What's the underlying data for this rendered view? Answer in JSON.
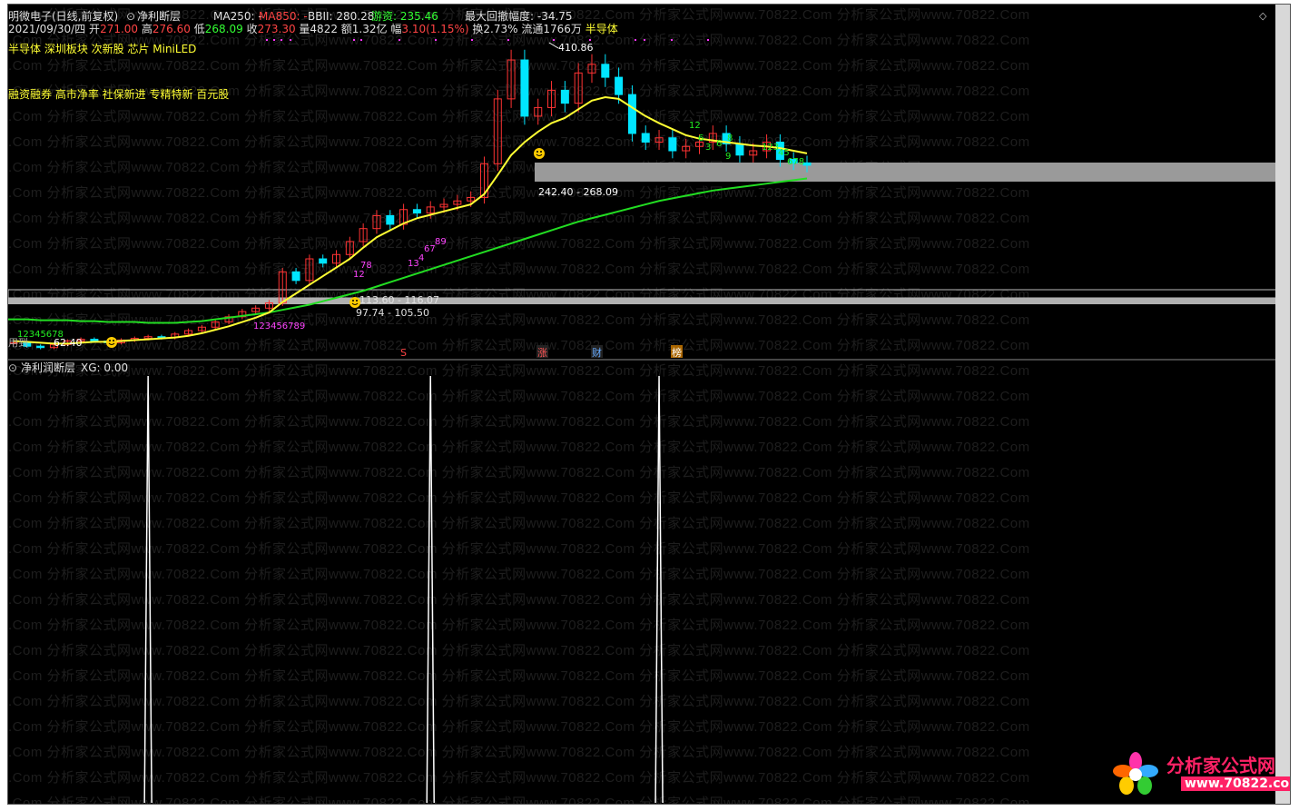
{
  "header": {
    "stock_name": "明微电子(日线,前复权)",
    "indicator_toggle": "⊙",
    "indicator_name": "净利断层",
    "ma250": "MA250: -",
    "ma850": "MA850: -",
    "bbi": "BBII: 280.28",
    "youzi": "游资: 235.46",
    "max_drawdown": "最大回撤幅度: -34.75"
  },
  "quote": {
    "date": "2021/09/30/四",
    "open_label": "开",
    "open": "271.00",
    "high_label": "高",
    "high": "276.60",
    "low_label": "低",
    "low": "268.09",
    "close_label": "收",
    "close": "273.30",
    "volume": "量4822",
    "amount": "额1.32亿",
    "amp_label": "幅",
    "amp": "3.10(1.15%)",
    "turnover": "换2.73%",
    "float": "流通1766万",
    "sector": "半导体"
  },
  "concepts_1": "半导体 深圳板块 次新股 芯片 MiniLED",
  "concepts_2": "融资融券 高市净率 社保新进 专精特新 百元股",
  "chart_labels": {
    "peak": "410.86",
    "gap_upper": "242.40 - 268.09",
    "gap_lower_1": "113.60 - 116.07",
    "gap_lower_2": "97.74 - 105.50",
    "low_price": "62.40",
    "event_s": "S",
    "event_zhang": "涨",
    "event_cai": "财",
    "event_bang": "榜",
    "left_cut": "用到"
  },
  "sub_panel": {
    "toggle": "⊙",
    "title": "净利润断层",
    "value": "XG: 0.00"
  },
  "watermark": {
    "unit": "分析家公式网www.70822.Com",
    "left_piece": ".Com"
  },
  "logo": {
    "name": "分析家公式网",
    "url": "www.70822.com"
  },
  "colors": {
    "background": "#000000",
    "candle_up": "#ff3333",
    "candle_down": "#00e5ff",
    "ma_yellow": "#ffff33",
    "ma_green": "#22dd22",
    "gap_band": "#9a9a9a",
    "signal_line": "#ffffff"
  },
  "chart_data": {
    "type": "candlestick",
    "x": [
      1,
      2,
      3,
      4,
      5,
      6,
      7,
      8,
      9,
      10,
      11,
      12,
      13,
      14,
      15,
      16,
      17,
      18,
      19,
      20,
      21,
      22,
      23,
      24,
      25,
      26,
      27,
      28,
      29,
      30,
      31,
      32,
      33,
      34,
      35,
      36,
      37,
      38,
      39,
      40,
      41,
      42,
      43,
      44,
      45,
      46,
      47,
      48,
      49,
      50,
      51,
      52,
      53,
      54,
      55,
      56,
      57,
      58,
      59,
      60
    ],
    "close": [
      68,
      64,
      62.4,
      66,
      70,
      72,
      70,
      68,
      71,
      73,
      75,
      74,
      78,
      82,
      86,
      92,
      98,
      104,
      108,
      114,
      150,
      140,
      165,
      160,
      170,
      185,
      200,
      215,
      205,
      222,
      218,
      225,
      228,
      232,
      236,
      275,
      350,
      395,
      330,
      340,
      360,
      345,
      380,
      390,
      375,
      355,
      310,
      300,
      305,
      290,
      295,
      300,
      310,
      298,
      285,
      290,
      300,
      280,
      276,
      273.3
    ],
    "ma_yellow": [
      70,
      69,
      68,
      67,
      67,
      68,
      69,
      69,
      70,
      71,
      72,
      73,
      74,
      76,
      79,
      83,
      87,
      92,
      97,
      103,
      115,
      125,
      135,
      145,
      155,
      165,
      178,
      190,
      198,
      206,
      212,
      216,
      220,
      224,
      228,
      240,
      262,
      285,
      300,
      312,
      322,
      328,
      338,
      348,
      352,
      350,
      340,
      330,
      322,
      315,
      308,
      304,
      302,
      300,
      298,
      296,
      295,
      293,
      290,
      287
    ],
    "ma_green": [
      95,
      95,
      94,
      94,
      94,
      93,
      93,
      92,
      92,
      92,
      91,
      91,
      91,
      92,
      93,
      95,
      97,
      99,
      101,
      103,
      106,
      109,
      112,
      116,
      120,
      124,
      128,
      133,
      138,
      143,
      148,
      153,
      158,
      163,
      168,
      173,
      178,
      183,
      188,
      193,
      198,
      203,
      208,
      212,
      216,
      220,
      224,
      228,
      232,
      235,
      238,
      241,
      244,
      246,
      248,
      250,
      252,
      254,
      256,
      258
    ],
    "gap_zones": [
      [
        242.4,
        268.09
      ],
      [
        113.6,
        116.07
      ],
      [
        97.74,
        105.5
      ]
    ],
    "signal_series": "XG",
    "signal_value": 0.0,
    "signal_spikes_at": [
      11,
      32,
      49
    ]
  }
}
